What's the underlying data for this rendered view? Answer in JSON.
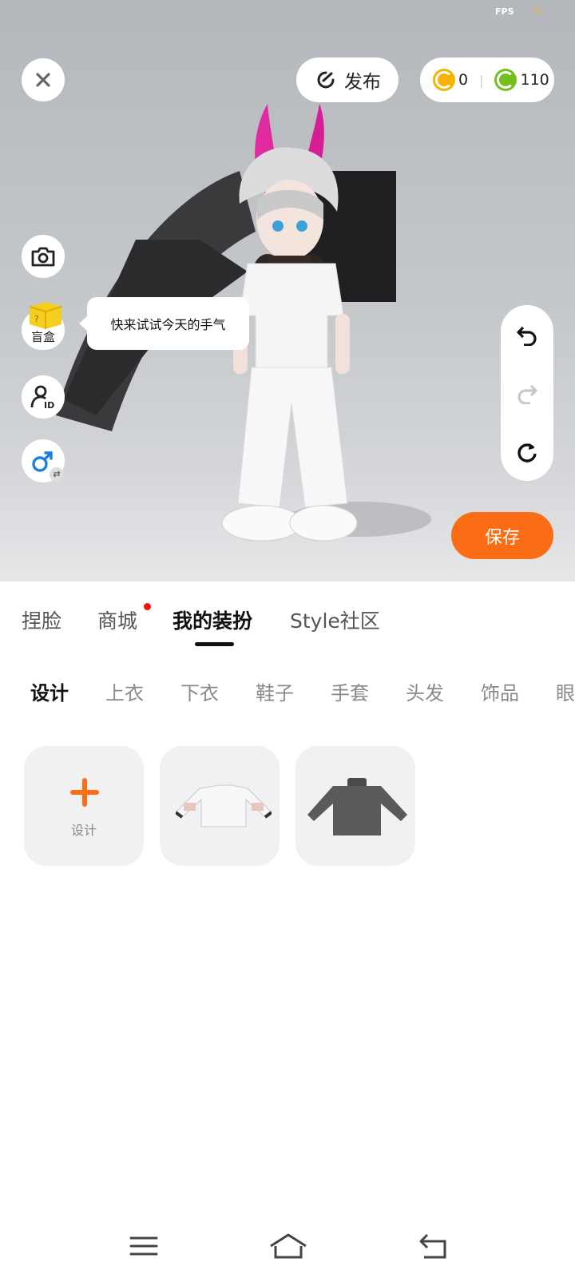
{
  "status": {
    "fps_label": "FPS",
    "fps_value": "72"
  },
  "header": {
    "close_icon": "close-icon",
    "publish_label": "发布",
    "coins_gold": "0",
    "coins_green": "110"
  },
  "left_tools": {
    "blindbox_label": "盲盒",
    "tooltip": "快来试试今天的手气"
  },
  "right_tools": [
    "undo-icon",
    "redo-icon",
    "reset-icon"
  ],
  "save_label": "保存",
  "tabs": [
    {
      "label": "捏脸"
    },
    {
      "label": "商城"
    },
    {
      "label": "我的装扮"
    },
    {
      "label": "Style社区"
    }
  ],
  "categories": [
    "设计",
    "上衣",
    "下衣",
    "鞋子",
    "手套",
    "头发",
    "饰品",
    "眼"
  ],
  "grid": {
    "design_label": "设计"
  },
  "colors": {
    "accent": "#fb6d14",
    "gold": "#f5b300",
    "green": "#73c01d"
  }
}
